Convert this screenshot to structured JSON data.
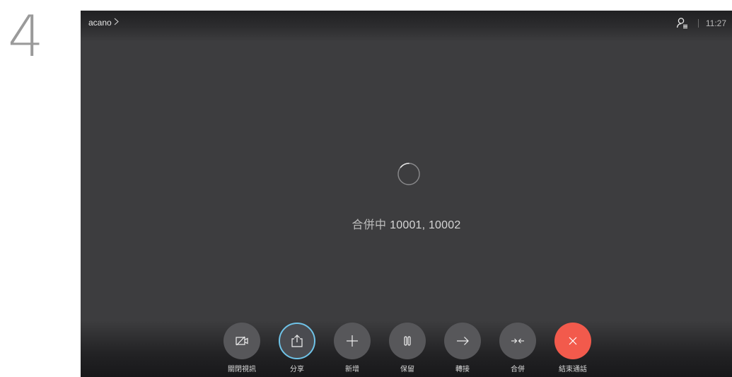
{
  "step": {
    "number": "4"
  },
  "header": {
    "call_name": "acano",
    "chevron": "chevron-right-icon",
    "participants_icon": "participants-icon",
    "time": "11:27"
  },
  "main": {
    "spinner_icon": "loading-spinner-icon",
    "status_prefix": "合併中",
    "status_numbers": "10001, 10002"
  },
  "controls": [
    {
      "label": "關閉視訊",
      "icon": "video-off-icon",
      "state": "default"
    },
    {
      "label": "分享",
      "icon": "share-icon",
      "state": "selected"
    },
    {
      "label": "新增",
      "icon": "plus-icon",
      "state": "default"
    },
    {
      "label": "保留",
      "icon": "hold-icon",
      "state": "default"
    },
    {
      "label": "轉接",
      "icon": "transfer-arrow-icon",
      "state": "default"
    },
    {
      "label": "合併",
      "icon": "merge-icon",
      "state": "default"
    },
    {
      "label": "結束通話",
      "icon": "close-icon",
      "state": "danger"
    }
  ],
  "colors": {
    "screen_bg": "#3d3d3f",
    "button_bg": "#57575a",
    "share_ring": "#6fc3e8",
    "end_call": "#f25a4c"
  }
}
